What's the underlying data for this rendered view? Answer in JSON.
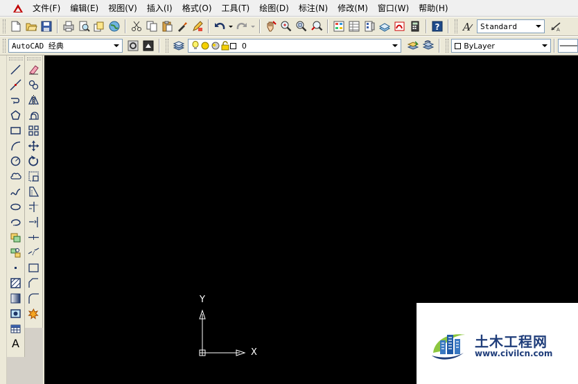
{
  "menubar": {
    "items": [
      {
        "label": "文件(F)"
      },
      {
        "label": "编辑(E)"
      },
      {
        "label": "视图(V)"
      },
      {
        "label": "插入(I)"
      },
      {
        "label": "格式(O)"
      },
      {
        "label": "工具(T)"
      },
      {
        "label": "绘图(D)"
      },
      {
        "label": "标注(N)"
      },
      {
        "label": "修改(M)"
      },
      {
        "label": "窗口(W)"
      },
      {
        "label": "帮助(H)"
      }
    ]
  },
  "toolbar": {
    "text_style": "Standard",
    "workspace": "AutoCAD 经典",
    "layer": "0",
    "color": "ByLayer"
  },
  "draw_tools": [
    "line",
    "construction-line",
    "polyline",
    "polygon",
    "rectangle",
    "arc",
    "circle",
    "revision-cloud",
    "spline",
    "ellipse",
    "ellipse-arc",
    "insert-block",
    "make-block",
    "point",
    "hatch",
    "gradient",
    "region",
    "table",
    "multiline-text"
  ],
  "text_tool_glyph": "A",
  "modify_tools": [
    "erase",
    "copy",
    "mirror",
    "offset",
    "array",
    "move",
    "rotate",
    "scale",
    "stretch",
    "trim",
    "extend",
    "break-at-point",
    "break",
    "join",
    "chamfer",
    "fillet",
    "explode"
  ],
  "ucs": {
    "x_label": "X",
    "y_label": "Y"
  },
  "watermark": {
    "title": "土木工程网",
    "url": "www.civilcn.com"
  },
  "colors": {
    "canvas_bg": "#000000",
    "toolbar_bg": "#ece9d8",
    "menubar_bg": "#f0f0f0",
    "watermark_text": "#1f3d7a",
    "watermark_accent": "#8cc63f"
  }
}
